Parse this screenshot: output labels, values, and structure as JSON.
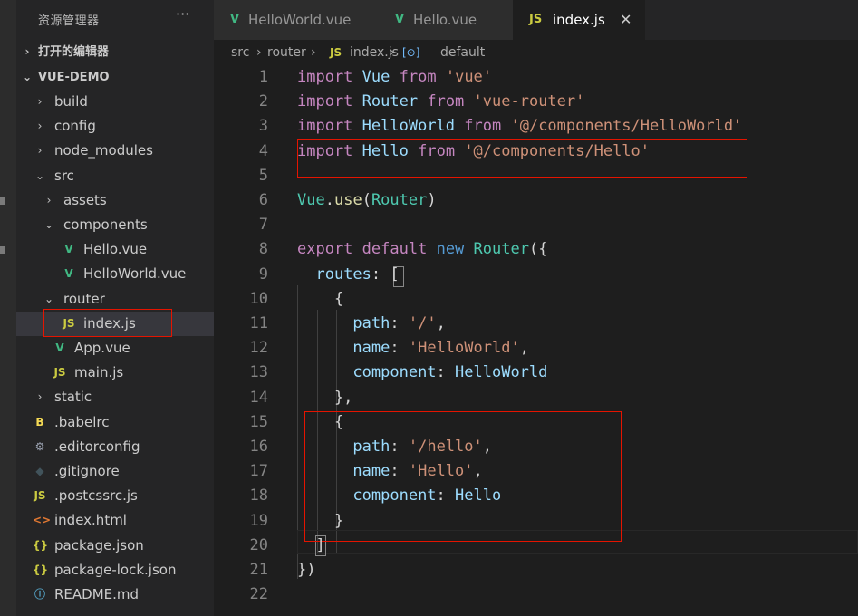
{
  "explorer": {
    "title": "资源管理器",
    "more": "···",
    "open_editors": "打开的编辑器",
    "project": "VUE-DEMO",
    "tree": [
      {
        "label": "build",
        "type": "folder",
        "indent": 0,
        "open": false
      },
      {
        "label": "config",
        "type": "folder",
        "indent": 0,
        "open": false
      },
      {
        "label": "node_modules",
        "type": "folder",
        "indent": 0,
        "open": false
      },
      {
        "label": "src",
        "type": "folder",
        "indent": 0,
        "open": true
      },
      {
        "label": "assets",
        "type": "folder",
        "indent": 1,
        "open": false
      },
      {
        "label": "components",
        "type": "folder",
        "indent": 1,
        "open": true
      },
      {
        "label": "Hello.vue",
        "type": "vue",
        "indent": 2
      },
      {
        "label": "HelloWorld.vue",
        "type": "vue",
        "indent": 2
      },
      {
        "label": "router",
        "type": "folder",
        "indent": 1,
        "open": true
      },
      {
        "label": "index.js",
        "type": "js",
        "indent": 2,
        "active": true
      },
      {
        "label": "App.vue",
        "type": "vue",
        "indent": 1
      },
      {
        "label": "main.js",
        "type": "js",
        "indent": 1
      },
      {
        "label": "static",
        "type": "folder",
        "indent": 0,
        "open": false
      },
      {
        "label": ".babelrc",
        "type": "babel",
        "indent": 0
      },
      {
        "label": ".editorconfig",
        "type": "gear",
        "indent": 0
      },
      {
        "label": ".gitignore",
        "type": "diamond",
        "indent": 0
      },
      {
        "label": ".postcssrc.js",
        "type": "js",
        "indent": 0
      },
      {
        "label": "index.html",
        "type": "html",
        "indent": 0
      },
      {
        "label": "package.json",
        "type": "json",
        "indent": 0
      },
      {
        "label": "package-lock.json",
        "type": "json",
        "indent": 0
      },
      {
        "label": "README.md",
        "type": "info",
        "indent": 0
      }
    ]
  },
  "icons": {
    "vue": {
      "glyph": "V",
      "color": "#41b883"
    },
    "js": {
      "glyph": "JS",
      "color": "#cbcb41"
    },
    "babel": {
      "glyph": "B",
      "color": "#f5da55"
    },
    "gear": {
      "glyph": "⚙",
      "color": "#9da5b4"
    },
    "diamond": {
      "glyph": "◆",
      "color": "#41535b"
    },
    "html": {
      "glyph": "<>",
      "color": "#e37933"
    },
    "json": {
      "glyph": "{}",
      "color": "#cbcb41"
    },
    "info": {
      "glyph": "ⓘ",
      "color": "#519aba"
    },
    "chevron_right": "›",
    "chevron_down": "⌄"
  },
  "tabs": [
    {
      "label": "HelloWorld.vue",
      "icon": "vue"
    },
    {
      "label": "Hello.vue",
      "icon": "vue"
    },
    {
      "label": "index.js",
      "icon": "js",
      "active": true,
      "close": "✕"
    }
  ],
  "breadcrumb": {
    "parts": [
      "src",
      "›",
      "router",
      "›",
      "JS",
      "index.js",
      "›",
      "[⊙]",
      "default"
    ]
  },
  "colors": {
    "keyword": "#c586c0",
    "type": "#4ec9b0",
    "string": "#ce9178",
    "property": "#9cdcfe",
    "plain": "#d4d4d4",
    "func": "#dcdcaa",
    "decl": "#569cd6",
    "annotation": "#e51400"
  },
  "code": [
    [
      [
        "keyword",
        "import"
      ],
      [
        "plain",
        " "
      ],
      [
        "property",
        "Vue"
      ],
      [
        "plain",
        " "
      ],
      [
        "keyword",
        "from"
      ],
      [
        "plain",
        " "
      ],
      [
        "string",
        "'vue'"
      ]
    ],
    [
      [
        "keyword",
        "import"
      ],
      [
        "plain",
        " "
      ],
      [
        "property",
        "Router"
      ],
      [
        "plain",
        " "
      ],
      [
        "keyword",
        "from"
      ],
      [
        "plain",
        " "
      ],
      [
        "string",
        "'vue-router'"
      ]
    ],
    [
      [
        "keyword",
        "import"
      ],
      [
        "plain",
        " "
      ],
      [
        "property",
        "HelloWorld"
      ],
      [
        "plain",
        " "
      ],
      [
        "keyword",
        "from"
      ],
      [
        "plain",
        " "
      ],
      [
        "string",
        "'@/components/HelloWorld'"
      ]
    ],
    [
      [
        "keyword",
        "import"
      ],
      [
        "plain",
        " "
      ],
      [
        "property",
        "Hello"
      ],
      [
        "plain",
        " "
      ],
      [
        "keyword",
        "from"
      ],
      [
        "plain",
        " "
      ],
      [
        "string",
        "'@/components/Hello'"
      ]
    ],
    [],
    [
      [
        "type",
        "Vue"
      ],
      [
        "plain",
        "."
      ],
      [
        "func",
        "use"
      ],
      [
        "plain",
        "("
      ],
      [
        "type",
        "Router"
      ],
      [
        "plain",
        ")"
      ]
    ],
    [],
    [
      [
        "keyword",
        "export"
      ],
      [
        "plain",
        " "
      ],
      [
        "keyword",
        "default"
      ],
      [
        "plain",
        " "
      ],
      [
        "decl",
        "new"
      ],
      [
        "plain",
        " "
      ],
      [
        "type",
        "Router"
      ],
      [
        "plain",
        "({"
      ]
    ],
    [
      [
        "plain",
        "  "
      ],
      [
        "property",
        "routes"
      ],
      [
        "plain",
        ": ["
      ]
    ],
    [
      [
        "plain",
        "    {"
      ]
    ],
    [
      [
        "plain",
        "      "
      ],
      [
        "property",
        "path"
      ],
      [
        "plain",
        ": "
      ],
      [
        "string",
        "'/'"
      ],
      [
        "plain",
        ","
      ]
    ],
    [
      [
        "plain",
        "      "
      ],
      [
        "property",
        "name"
      ],
      [
        "plain",
        ": "
      ],
      [
        "string",
        "'HelloWorld'"
      ],
      [
        "plain",
        ","
      ]
    ],
    [
      [
        "plain",
        "      "
      ],
      [
        "property",
        "component"
      ],
      [
        "plain",
        ": "
      ],
      [
        "property",
        "HelloWorld"
      ]
    ],
    [
      [
        "plain",
        "    },"
      ]
    ],
    [
      [
        "plain",
        "    {"
      ]
    ],
    [
      [
        "plain",
        "      "
      ],
      [
        "property",
        "path"
      ],
      [
        "plain",
        ": "
      ],
      [
        "string",
        "'/hello'"
      ],
      [
        "plain",
        ","
      ]
    ],
    [
      [
        "plain",
        "      "
      ],
      [
        "property",
        "name"
      ],
      [
        "plain",
        ": "
      ],
      [
        "string",
        "'Hello'"
      ],
      [
        "plain",
        ","
      ]
    ],
    [
      [
        "plain",
        "      "
      ],
      [
        "property",
        "component"
      ],
      [
        "plain",
        ": "
      ],
      [
        "property",
        "Hello"
      ]
    ],
    [
      [
        "plain",
        "    }"
      ]
    ],
    [
      [
        "plain",
        "  ]"
      ]
    ],
    [
      [
        "plain",
        "})"
      ]
    ],
    []
  ]
}
